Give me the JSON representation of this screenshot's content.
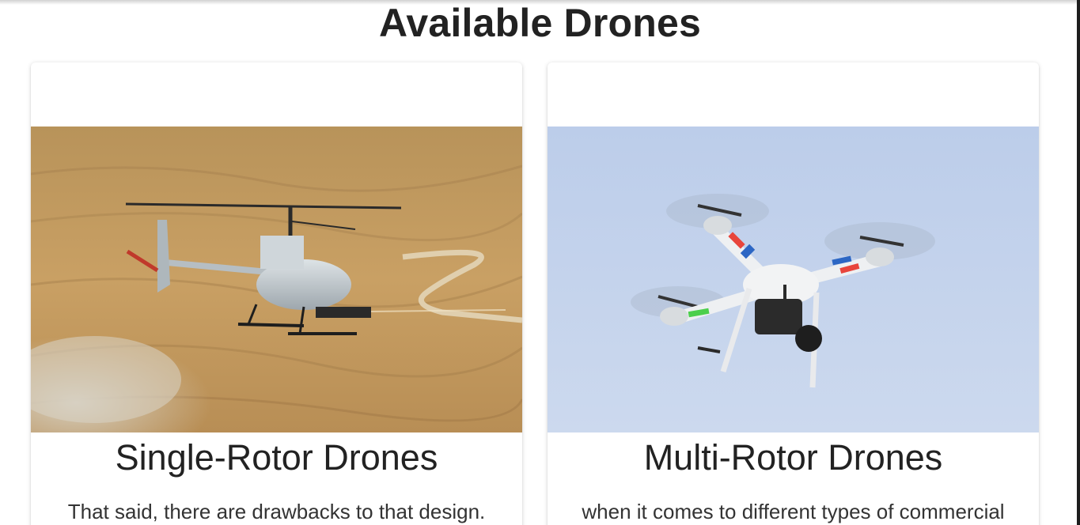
{
  "page": {
    "title": "Available Drones"
  },
  "cards": [
    {
      "title": "Single-Rotor Drones",
      "text": "That said, there are drawbacks to that design.",
      "image_subject": "single-rotor helicopter drone over desert"
    },
    {
      "title": "Multi-Rotor Drones",
      "text": "when it comes to different types of commercial",
      "image_subject": "white quadcopter drone with camera against sky"
    }
  ],
  "colors": {
    "background": "#ffffff",
    "text": "#222222",
    "desert": "#c9a064",
    "sky": "#c3d4ee"
  }
}
